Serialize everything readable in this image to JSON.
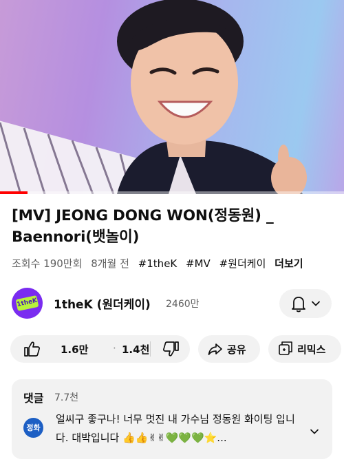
{
  "video": {
    "progress_fraction": 0.08
  },
  "title": "[MV] JEONG DONG WON(정동원) _ Baennori(뱃놀이)",
  "meta": {
    "views": "조회수 190만회",
    "age": "8개월 전",
    "tags": [
      "#1theK",
      "#MV",
      "#원더케이"
    ],
    "more": "더보기"
  },
  "channel": {
    "avatar_text": "1theK",
    "name": "1theK (원더케이)",
    "subscribers": "2460만",
    "bell_icon": "bell-icon",
    "chevron_icon": "chevron-down-icon"
  },
  "actions": {
    "likes": "1.6만",
    "separator": "·",
    "dislike_count": "1.4천",
    "share": "공유",
    "remix": "리믹스"
  },
  "comments": {
    "heading": "댓글",
    "count": "7.7천",
    "avatar_text": "정화",
    "top_comment": "얼씨구 좋구나! 너무 멋진 내 가수님 정동원 화이팅 입니다. 대박입니다 👍👍✌✌💚💚💚⭐..."
  },
  "colors": {
    "progress": "#ff0000",
    "pill_bg": "#f2f2f2",
    "channel_avatar": "#7a2cf0",
    "comment_avatar": "#1d5fc4"
  }
}
